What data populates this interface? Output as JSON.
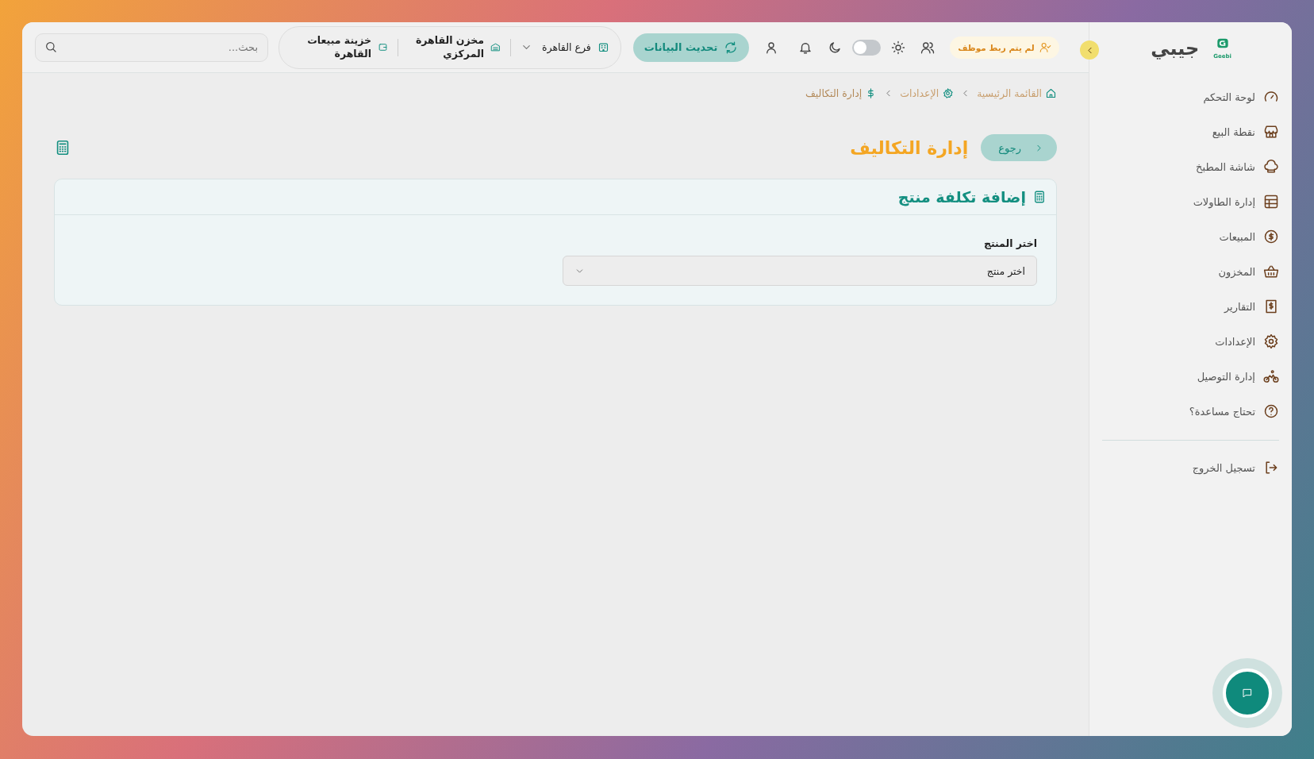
{
  "sidebar": {
    "logo_text": "Geebi",
    "brand": "جيبي",
    "collapsed": false,
    "items": [
      {
        "label": "لوحة التحكم"
      },
      {
        "label": "نقطة البيع"
      },
      {
        "label": "شاشة المطبخ"
      },
      {
        "label": "إدارة الطاولات"
      },
      {
        "label": "المبيعات"
      },
      {
        "label": "المخزون"
      },
      {
        "label": "التقارير"
      },
      {
        "label": "الإعدادات"
      },
      {
        "label": "إدارة التوصيل"
      },
      {
        "label": "تحتاج مساعدة؟"
      }
    ],
    "logout": "تسجيل الخروج"
  },
  "topbar": {
    "employee_badge": "لم يتم ربط موظف",
    "dark_mode": false,
    "refresh_button": "تحديث البيانات",
    "branch": "فرع القاهرة",
    "warehouse": "مخزن القاهرة المركزي",
    "cashbox": "خزينة مبيعات القاهرة",
    "search": {
      "placeholder": "بحث..."
    }
  },
  "breadcrumb": [
    {
      "label": "القائمة الرئيسية",
      "current": false
    },
    {
      "label": "الإعدادات",
      "current": false
    },
    {
      "label": "إدارة التكاليف",
      "current": true
    }
  ],
  "page": {
    "back_button": "رجوع",
    "title": "إدارة التكاليف"
  },
  "card": {
    "title": "إضافة تكلفة منتج",
    "field_label": "اختر المنتج",
    "select": {
      "value": "اختر منتج"
    }
  }
}
